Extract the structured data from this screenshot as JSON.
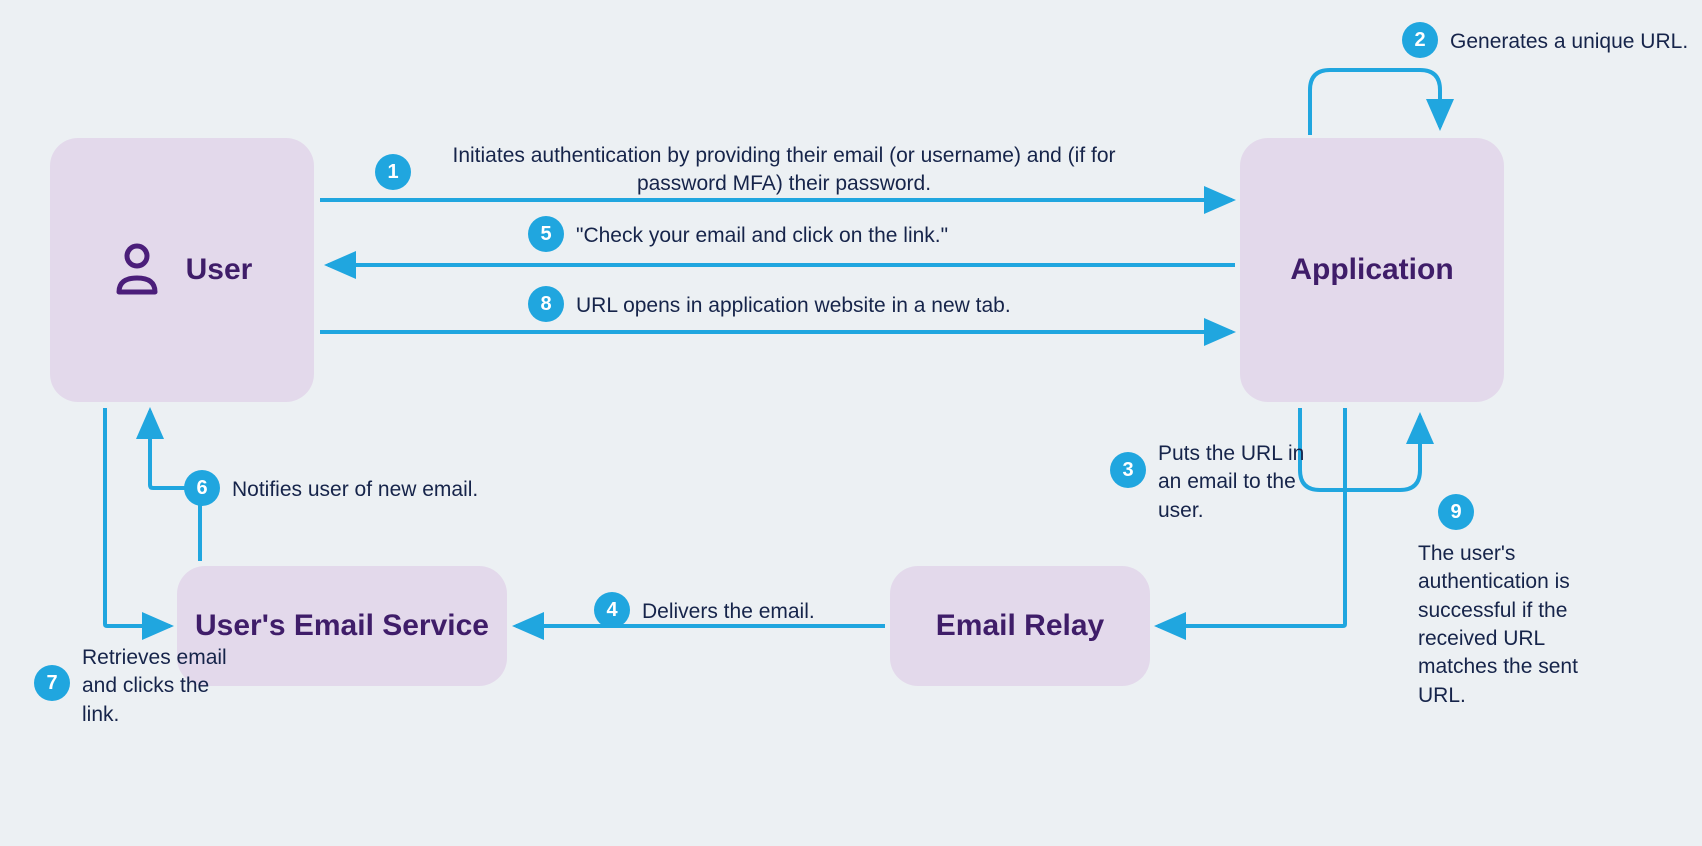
{
  "nodes": {
    "user": "User",
    "application": "Application",
    "email_service": "User's Email Service",
    "email_relay": "Email Relay"
  },
  "steps": {
    "s1": {
      "num": "1",
      "text": "Initiates authentication by providing their email (or username) and (if for password MFA) their password."
    },
    "s2": {
      "num": "2",
      "text": "Generates a unique URL."
    },
    "s3": {
      "num": "3",
      "text": "Puts the URL in an email to the user."
    },
    "s4": {
      "num": "4",
      "text": "Delivers the email."
    },
    "s5": {
      "num": "5",
      "text": "\"Check your email and click on the link.\""
    },
    "s6": {
      "num": "6",
      "text": "Notifies user of new email."
    },
    "s7": {
      "num": "7",
      "text": "Retrieves email and clicks the link."
    },
    "s8": {
      "num": "8",
      "text": "URL opens in application website in a new tab."
    },
    "s9": {
      "num": "9",
      "text": "The user's authentication is successful if the received URL matches the sent URL."
    }
  },
  "colors": {
    "arrow": "#20a6df",
    "badge": "#20a6df",
    "node_bg": "#e3d9eb",
    "node_text": "#3f1d69",
    "step_text": "#16244a",
    "bg": "#ecf0f3"
  }
}
